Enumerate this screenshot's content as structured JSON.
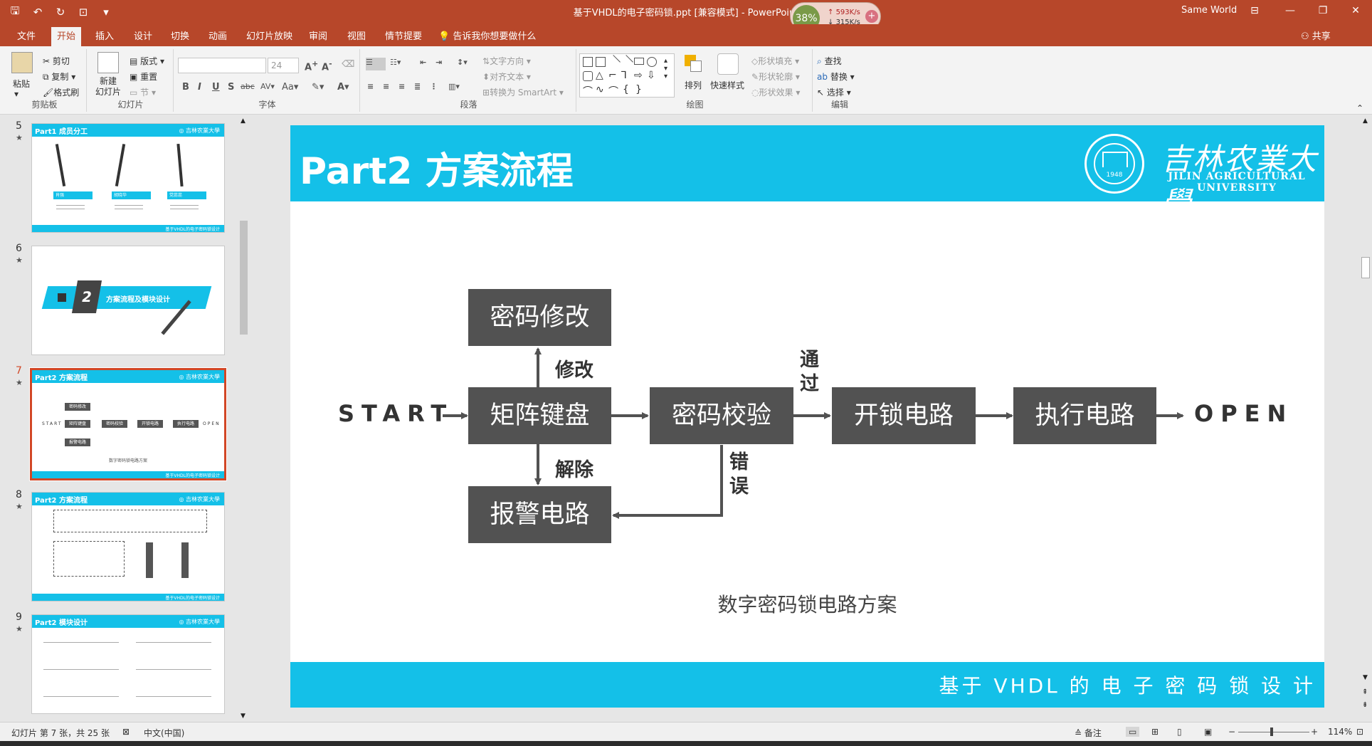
{
  "window": {
    "title": "基于VHDL的电子密码锁.ppt [兼容模式]  -  PowerPoint",
    "user": "Same World",
    "net": {
      "percent": "38%",
      "up": "593K/s",
      "down": "315K/s"
    }
  },
  "tabs": [
    "文件",
    "开始",
    "插入",
    "设计",
    "切换",
    "动画",
    "幻灯片放映",
    "审阅",
    "视图",
    "情节提要"
  ],
  "active_tab": "开始",
  "tell_me": "告诉我你想要做什么",
  "share": "共享",
  "ribbon": {
    "clipboard": {
      "label": "剪贴板",
      "paste": "粘贴",
      "cut": "剪切",
      "copy": "复制",
      "format_painter": "格式刷"
    },
    "slides": {
      "label": "幻灯片",
      "new_slide": "新建\n幻灯片",
      "layout": "版式",
      "reset": "重置",
      "section": "节"
    },
    "font": {
      "label": "字体",
      "font_name": "",
      "font_size": "24"
    },
    "paragraph": {
      "label": "段落",
      "text_direction": "文字方向",
      "align_text": "对齐文本",
      "smartart": "转换为 SmartArt"
    },
    "drawing": {
      "label": "绘图",
      "arrange": "排列",
      "quick_styles": "快速样式",
      "shape_fill": "形状填充",
      "shape_outline": "形状轮廓",
      "shape_effects": "形状效果"
    },
    "editing": {
      "label": "编辑",
      "find": "查找",
      "replace": "替换",
      "select": "选择"
    }
  },
  "thumbnails": [
    {
      "num": "5",
      "title": "Part1 成员分工",
      "labels": [
        "肖强",
        "胡晓华",
        "党蕊蕊"
      ]
    },
    {
      "num": "6",
      "title": "",
      "section_num": "2",
      "section_title": "方案流程及模块设计"
    },
    {
      "num": "7",
      "title": "Part2 方案流程"
    },
    {
      "num": "8",
      "title": "Part2 方案流程"
    },
    {
      "num": "9",
      "title": "Part2 模块设计"
    }
  ],
  "thumb_footer": "基于VHDL的电子密码锁设计",
  "slide": {
    "title": "Part2 方案流程",
    "logo_cn": "吉林农業大學",
    "logo_en": "JILIN AGRICULTURAL UNIVERSITY",
    "emblem_year": "1948",
    "footer": "基于 VHDL 的 电 子 密 码 锁 设 计",
    "caption": "数字密码锁电路方案",
    "diagram": {
      "start": "START",
      "open": "OPEN",
      "boxes": {
        "modify": "密码修改",
        "keypad": "矩阵键盘",
        "verify": "密码校验",
        "unlock": "开锁电路",
        "execute": "执行电路",
        "alarm": "报警电路"
      },
      "labels": {
        "modify": "修改",
        "release": "解除",
        "pass": "通过",
        "error": "错误"
      }
    }
  },
  "status": {
    "slide_info": "幻灯片 第 7 张，共 25 张",
    "language": "中文(中国)",
    "notes": "备注",
    "zoom": "114%"
  }
}
